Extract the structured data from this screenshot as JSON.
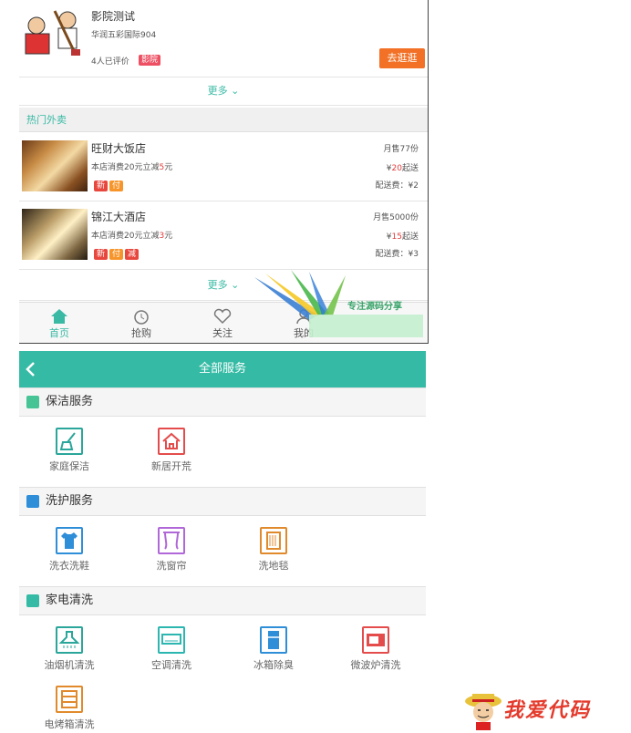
{
  "top_screen": {
    "shop": {
      "name": "影院测试",
      "address": "华润五彩国际904",
      "reviews": "4人已评价",
      "tag": "影院",
      "button": "去逛逛"
    },
    "more_label": "更多",
    "section_title": "热门外卖",
    "restaurants": [
      {
        "name": "旺财大饭店",
        "promo_pre": "本店消费20元立减",
        "promo_num": "5",
        "promo_post": "元",
        "badges": [
          "新",
          "付"
        ],
        "sales": "月售77份",
        "min_yen": "¥",
        "min_num": "20",
        "min_post": "起送",
        "fee": "配送费：¥2"
      },
      {
        "name": "锦江大酒店",
        "promo_pre": "本店消费20元立减",
        "promo_num": "3",
        "promo_post": "元",
        "badges": [
          "新",
          "付",
          "减"
        ],
        "sales": "月售5000份",
        "min_yen": "¥",
        "min_num": "15",
        "min_post": "起送",
        "fee": "配送费：¥3"
      }
    ],
    "tabs": [
      "首页",
      "抢购",
      "关注",
      "我的"
    ],
    "watermark_text": "专注源码分享"
  },
  "services": {
    "title": "全部服务",
    "categories": [
      {
        "label": "保洁服务",
        "items": [
          {
            "label": "家庭保洁",
            "icon": "broom-icon",
            "color": "#2aa69a"
          },
          {
            "label": "新居开荒",
            "icon": "house-icon",
            "color": "#e44c4c"
          }
        ]
      },
      {
        "label": "洗护服务",
        "items": [
          {
            "label": "洗衣洗鞋",
            "icon": "shirt-icon",
            "color": "#2f8ed8"
          },
          {
            "label": "洗窗帘",
            "icon": "curtain-icon",
            "color": "#b067d8"
          },
          {
            "label": "洗地毯",
            "icon": "carpet-icon",
            "color": "#e08a2c"
          }
        ]
      },
      {
        "label": "家电清洗",
        "items": [
          {
            "label": "油烟机清洗",
            "icon": "range-hood-icon",
            "color": "#2aa69a"
          },
          {
            "label": "空调清洗",
            "icon": "air-conditioner-icon",
            "color": "#2bb6b0"
          },
          {
            "label": "冰箱除臭",
            "icon": "fridge-icon",
            "color": "#2f8ed8"
          },
          {
            "label": "微波炉清洗",
            "icon": "microwave-icon",
            "color": "#e44c4c"
          },
          {
            "label": "电烤箱清洗",
            "icon": "oven-icon",
            "color": "#e08a2c"
          }
        ]
      }
    ]
  },
  "watermark_bottom": "我爱代码"
}
